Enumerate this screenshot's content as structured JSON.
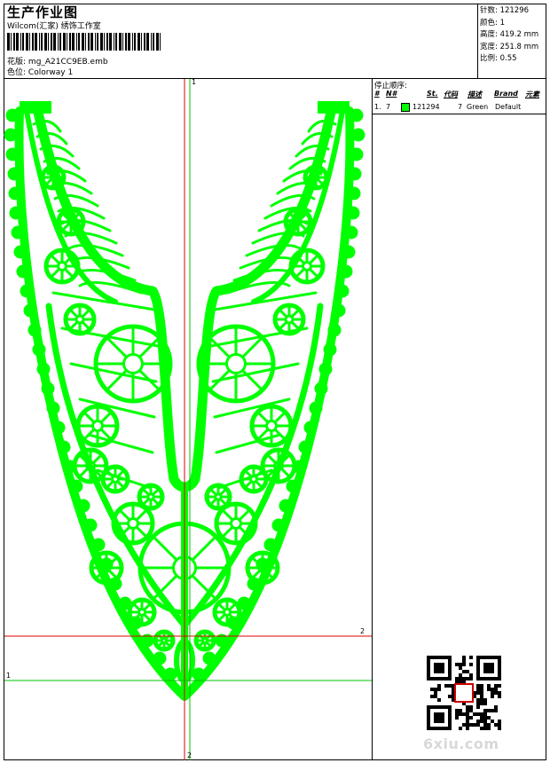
{
  "header": {
    "title": "生产作业图",
    "company": "Wilcom(汇家) 绣饰工作室",
    "design_label": "花版:",
    "design_file": "mg_A21CC9EB.emb",
    "colorway_label": "色位:",
    "colorway": "Colorway 1"
  },
  "stats": [
    {
      "label": "针数:",
      "value": "121296"
    },
    {
      "label": "颜色:",
      "value": "1"
    },
    {
      "label": "高度:",
      "value": "419.2 mm"
    },
    {
      "label": "宽度:",
      "value": "251.8 mm"
    },
    {
      "label": "比例:",
      "value": "0.55"
    }
  ],
  "stop_sequence": {
    "title": "停止顺序:",
    "headers": [
      "#",
      "N#",
      "St.",
      "代码",
      "描述",
      "Brand",
      "元素"
    ],
    "rows": [
      {
        "index": "1.",
        "needle": "7",
        "swatch_color": "#00ff00",
        "stitches": "121294",
        "code": "7",
        "description": "Green",
        "brand": "Default"
      }
    ]
  },
  "axes": {
    "vertical_top": "1",
    "vertical_bottom": "2",
    "horizontal_right": "2",
    "horizontal_left": "1"
  },
  "colors": {
    "thread": "#00ff00",
    "crosshair_red": "#e00000",
    "crosshair_green": "#00c000"
  },
  "watermark": "6xiu.com"
}
